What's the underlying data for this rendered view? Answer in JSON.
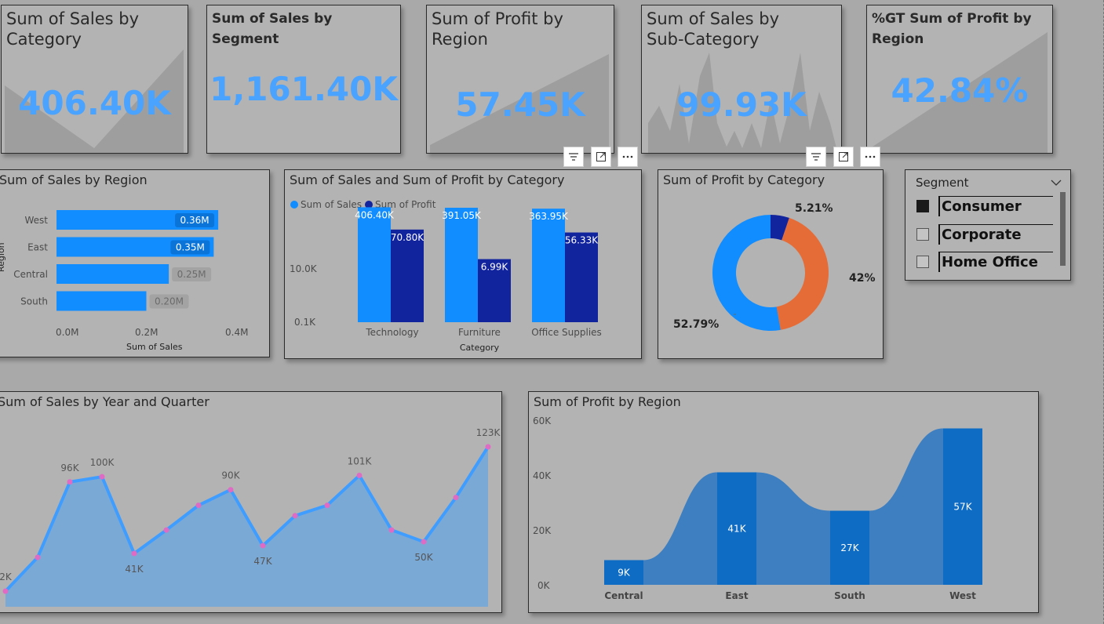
{
  "kpis": [
    {
      "title": "Sum of Sales by Category",
      "value": "406.40K"
    },
    {
      "title": "Sum of Sales by Segment",
      "value": "1,161.40K"
    },
    {
      "title": "Sum of Profit by Region",
      "value": "57.45K"
    },
    {
      "title": "Sum of Sales by Sub-Category",
      "value": "99.93K"
    },
    {
      "title": "%GT Sum of Profit by Region",
      "value": "42.84%"
    }
  ],
  "sales_region": {
    "title": "Sum of Sales by Region",
    "y_label": "Region",
    "x_label": "Sum of Sales",
    "x_ticks": [
      "0.0M",
      "0.2M",
      "0.4M"
    ]
  },
  "sales_profit_category": {
    "title": "Sum of Sales and Sum of Profit by Category",
    "legend": [
      "Sum of Sales",
      "Sum of Profit"
    ],
    "x_label": "Category",
    "y_ticks": [
      "10.0K",
      "0.1K"
    ]
  },
  "profit_category": {
    "title": "Sum of Profit by Category"
  },
  "slicer": {
    "title": "Segment",
    "items": [
      {
        "label": "Consumer",
        "checked": true
      },
      {
        "label": "Corporate",
        "checked": false
      },
      {
        "label": "Home Office",
        "checked": false
      }
    ]
  },
  "sales_quarter": {
    "title": "Sum of Sales by Year and Quarter"
  },
  "profit_region": {
    "title": "Sum of Profit by Region",
    "y_ticks": [
      "60K",
      "40K",
      "20K",
      "0K"
    ]
  },
  "colors": {
    "accent": "#118dff",
    "dark": "#12239e",
    "orange": "#e66c37",
    "kpi": "#4aa3ff",
    "ribbon": "#0f6cc4"
  },
  "chart_data": [
    {
      "type": "bar",
      "title": "Sum of Sales by Region",
      "categories": [
        "West",
        "East",
        "Central",
        "South"
      ],
      "values": [
        0.36,
        0.35,
        0.25,
        0.2
      ],
      "labels": [
        "0.36M",
        "0.35M",
        "0.25M",
        "0.20M"
      ],
      "xlabel": "Sum of Sales",
      "ylabel": "Region",
      "xlim": [
        0,
        0.4
      ]
    },
    {
      "type": "bar",
      "title": "Sum of Sales and Sum of Profit by Category",
      "categories": [
        "Technology",
        "Furniture",
        "Office Supplies"
      ],
      "series": [
        {
          "name": "Sum of Sales",
          "values": [
            406.4,
            391.05,
            363.95
          ],
          "labels": [
            "406.40K",
            "391.05K",
            "363.95K"
          ]
        },
        {
          "name": "Sum of Profit",
          "values": [
            70.8,
            6.99,
            56.33
          ],
          "labels": [
            "70.80K",
            "6.99K",
            "56.33K"
          ]
        }
      ],
      "xlabel": "Category",
      "yscale": "log"
    },
    {
      "type": "pie",
      "title": "Sum of Profit by Category",
      "values": [
        52.79,
        42,
        5.21
      ],
      "labels": [
        "52.79%",
        "42%",
        "5.21%"
      ]
    },
    {
      "type": "area",
      "title": "Sum of Sales by Year and Quarter",
      "x": [
        1,
        2,
        3,
        4,
        5,
        6,
        7,
        8,
        9,
        10,
        11,
        12,
        13,
        14,
        15,
        16
      ],
      "values": [
        12,
        38,
        96,
        100,
        41,
        59,
        78,
        90,
        47,
        70,
        78,
        101,
        59,
        50,
        84,
        123
      ],
      "labels": [
        "2K",
        "",
        "96K",
        "100K",
        "41K",
        "",
        "",
        "90K",
        "47K",
        "",
        "",
        "101K",
        "",
        "50K",
        "",
        "123K"
      ]
    },
    {
      "type": "bar",
      "title": "Sum of Profit by Region",
      "categories": [
        "Central",
        "East",
        "South",
        "West"
      ],
      "values": [
        9,
        41,
        27,
        57
      ],
      "labels": [
        "9K",
        "41K",
        "27K",
        "57K"
      ],
      "ylim": [
        0,
        60
      ]
    }
  ]
}
